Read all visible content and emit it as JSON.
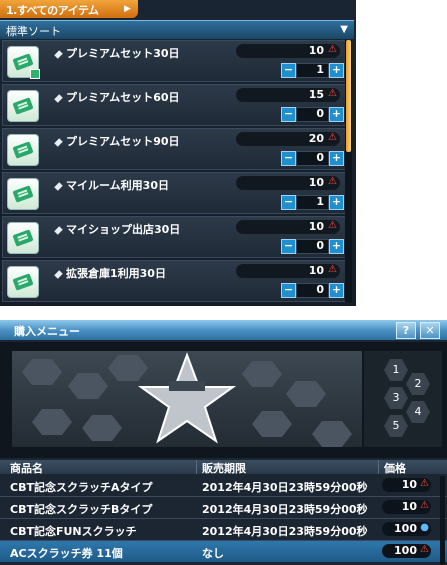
{
  "top": {
    "tab_label": "1.すべてのアイテム",
    "sort_label": "標準ソート",
    "items": [
      {
        "name": "プレミアムセット30日",
        "price": "10",
        "qty": "1"
      },
      {
        "name": "プレミアムセット60日",
        "price": "15",
        "qty": "0"
      },
      {
        "name": "プレミアムセット90日",
        "price": "20",
        "qty": "0"
      },
      {
        "name": "マイルーム利用30日",
        "price": "10",
        "qty": "1"
      },
      {
        "name": "マイショップ出店30日",
        "price": "10",
        "qty": "0"
      },
      {
        "name": "拡張倉庫1利用30日",
        "price": "10",
        "qty": "0"
      }
    ]
  },
  "bottom": {
    "title": "購入メニュー",
    "help": "?",
    "close": "✕",
    "columns": [
      "商品名",
      "販売期限",
      "価格"
    ],
    "banner_slots": [
      "1",
      "2",
      "3",
      "4",
      "5"
    ],
    "rows": [
      {
        "name": "CBT記念スクラッチAタイプ",
        "period": "2012年4月30日23時59分00秒",
        "price": "10",
        "currency": "ac"
      },
      {
        "name": "CBT記念スクラッチBタイプ",
        "period": "2012年4月30日23時59分00秒",
        "price": "10",
        "currency": "ac"
      },
      {
        "name": "CBT記念FUNスクラッチ",
        "period": "2012年4月30日23時59分00秒",
        "price": "100",
        "currency": "fun"
      },
      {
        "name": "ACスクラッチ券 11個",
        "period": "なし",
        "price": "100",
        "currency": "ac"
      }
    ]
  },
  "colors": {
    "accent_orange": "#e8922a",
    "accent_blue": "#2f6f9d",
    "ac_currency": "#ff4a3a",
    "fun_currency": "#5cb8ff"
  },
  "icons": {
    "ac": "triangle-warning-icon",
    "fun": "fun-coin-icon"
  }
}
